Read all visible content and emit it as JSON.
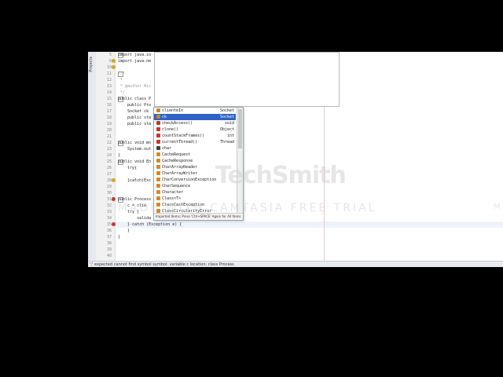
{
  "editor": {
    "projects_label": "Projects",
    "line_numbers": [
      "5",
      "6",
      "10",
      "11",
      "12",
      "13",
      "14",
      "15",
      "16",
      "17",
      "18",
      "19",
      "20",
      "21",
      "22",
      "23",
      "24",
      "25",
      "26",
      "27",
      "28",
      "29",
      "30",
      "31",
      "32",
      "33",
      "34",
      "35",
      "36",
      "37",
      "38",
      "39",
      "40"
    ],
    "lines": [
      "import java.io",
      "import java.ne",
      "",
      "/**",
      " *",
      " * @author Nic",
      " */",
      "public class P",
      "    public Pro",
      "    Socket ck",
      "    public sta",
      "    public sta",
      "",
      "",
      "public void mo",
      "    System.out",
      "}",
      "public void En",
      "    try{",
      "        ",
      "    }catch(Exc",
      "",
      "",
      "public Process",
      "    c = clie",
      "    try {",
      "        salida = c",
      "    } catch (Exception e) {",
      "    }",
      "}",
      "",
      ""
    ]
  },
  "completion": {
    "items": [
      {
        "label": "clienteIn",
        "type": "Socket",
        "icon": "field-icon",
        "color": "#c08a2a"
      },
      {
        "label": "ck",
        "type": "Socket",
        "icon": "field-icon",
        "color": "#c08a2a"
      },
      {
        "label": "checkAccess()",
        "type": "void",
        "icon": "method-icon",
        "color": "#c0392b"
      },
      {
        "label": "clone()",
        "type": "Object",
        "icon": "method-icon",
        "color": "#c0392b"
      },
      {
        "label": "countStackFrames()",
        "type": "int",
        "icon": "method-icon",
        "color": "#c0392b"
      },
      {
        "label": "currentThread()",
        "type": "Thread",
        "icon": "method-icon",
        "color": "#c0392b"
      },
      {
        "label": "char",
        "type": "",
        "icon": "keyword-icon",
        "color": "#444444"
      },
      {
        "label": "CacheRequest",
        "type": "",
        "icon": "class-icon",
        "color": "#d28b26"
      },
      {
        "label": "CacheResponse",
        "type": "",
        "icon": "class-icon",
        "color": "#d28b26"
      },
      {
        "label": "CharArrayReader",
        "type": "",
        "icon": "class-icon",
        "color": "#d28b26"
      },
      {
        "label": "CharArrayWriter",
        "type": "",
        "icon": "class-icon",
        "color": "#d28b26"
      },
      {
        "label": "CharConversionException",
        "type": "",
        "icon": "class-icon",
        "color": "#d28b26"
      },
      {
        "label": "CharSequence",
        "type": "",
        "icon": "class-icon",
        "color": "#d28b26"
      },
      {
        "label": "Character",
        "type": "",
        "icon": "class-icon",
        "color": "#d28b26"
      },
      {
        "label": "Class<T>",
        "type": "",
        "icon": "class-icon",
        "color": "#d28b26"
      },
      {
        "label": "ClassCastException",
        "type": "",
        "icon": "class-icon",
        "color": "#d28b26"
      },
      {
        "label": "ClassCircularityError",
        "type": "",
        "icon": "class-icon",
        "color": "#d28b26"
      }
    ],
    "hint": "Imported Items; Press 'Ctrl+SPACE' Again for All Items"
  },
  "status": {
    "text": "';' expected   cannot find symbol  symbol: variable c  location: class Process"
  },
  "watermark": {
    "brand": "TechSmith",
    "trial": "MADE WITH CAMTASIA FREE TRIAL",
    "edge": "M"
  }
}
